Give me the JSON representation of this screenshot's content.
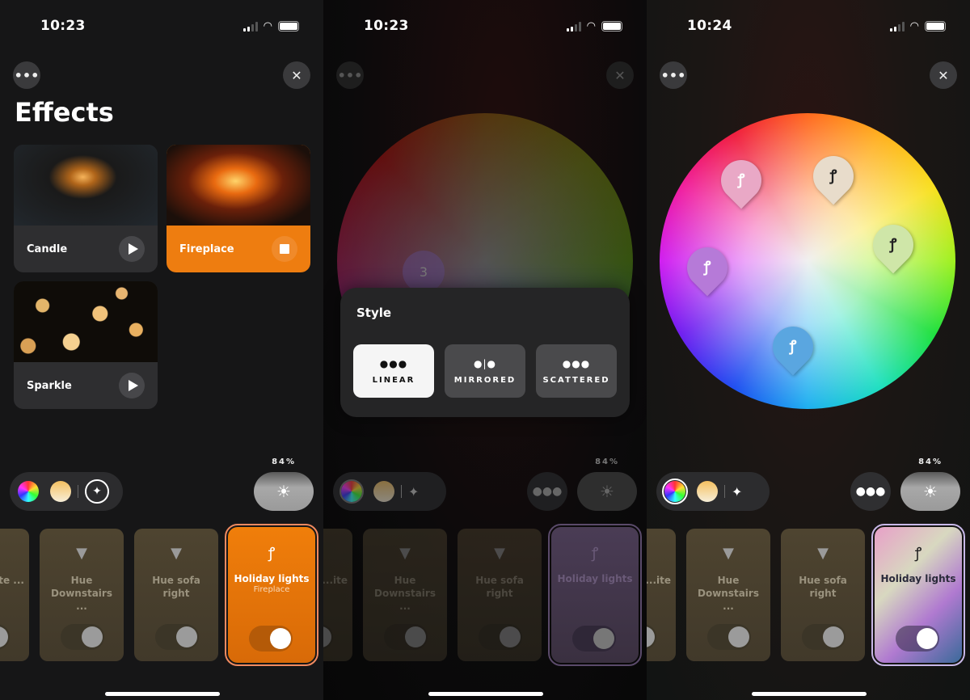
{
  "screens": [
    {
      "status": {
        "time": "10:23"
      },
      "title": "Effects",
      "effects": [
        {
          "label": "Candle",
          "state": "play"
        },
        {
          "label": "Fireplace",
          "state": "stop",
          "active": true
        },
        {
          "label": "Sparkle",
          "state": "play"
        }
      ],
      "brightness": "84%",
      "lights": [
        {
          "name": "...ite ...",
          "partial": true
        },
        {
          "name": "Hue Downstairs ..."
        },
        {
          "name": "Hue sofa right"
        },
        {
          "name": "Holiday lights",
          "subtitle": "Fireplace",
          "on": true
        }
      ]
    },
    {
      "status": {
        "time": "10:23"
      },
      "wheel_marker": "3",
      "style_sheet": {
        "title": "Style",
        "options": [
          {
            "label": "LINEAR",
            "icon": "linear-icon",
            "selected": true
          },
          {
            "label": "MIRRORED",
            "icon": "mirrored-icon"
          },
          {
            "label": "SCATTERED",
            "icon": "scattered-icon"
          }
        ]
      },
      "brightness": "84%",
      "lights": [
        {
          "name": "...ite"
        },
        {
          "name": "Hue Downstairs ..."
        },
        {
          "name": "Hue sofa right"
        },
        {
          "name": "Holiday lights",
          "on": true
        }
      ]
    },
    {
      "status": {
        "time": "10:24"
      },
      "pins": [
        {
          "color": "#e9a8c6",
          "label": "pink"
        },
        {
          "color": "#e8dccb",
          "label": "warm-white"
        },
        {
          "color": "#cfe6a8",
          "label": "light-green"
        },
        {
          "color": "#b67ad8",
          "label": "purple"
        },
        {
          "color": "#5aa6e0",
          "label": "blue"
        }
      ],
      "brightness": "84%",
      "lights": [
        {
          "name": "...ite"
        },
        {
          "name": "Hue Downstairs ..."
        },
        {
          "name": "Hue sofa right"
        },
        {
          "name": "Holiday lights",
          "on": true
        }
      ]
    }
  ],
  "icons": {
    "more": "•••",
    "close": "✕",
    "sun": "☀",
    "sparkle": "✦",
    "bulb": "▼",
    "string_lights": "ꝭ",
    "linear": "●●●",
    "mirrored": "●|●",
    "scattered": "●●●"
  }
}
